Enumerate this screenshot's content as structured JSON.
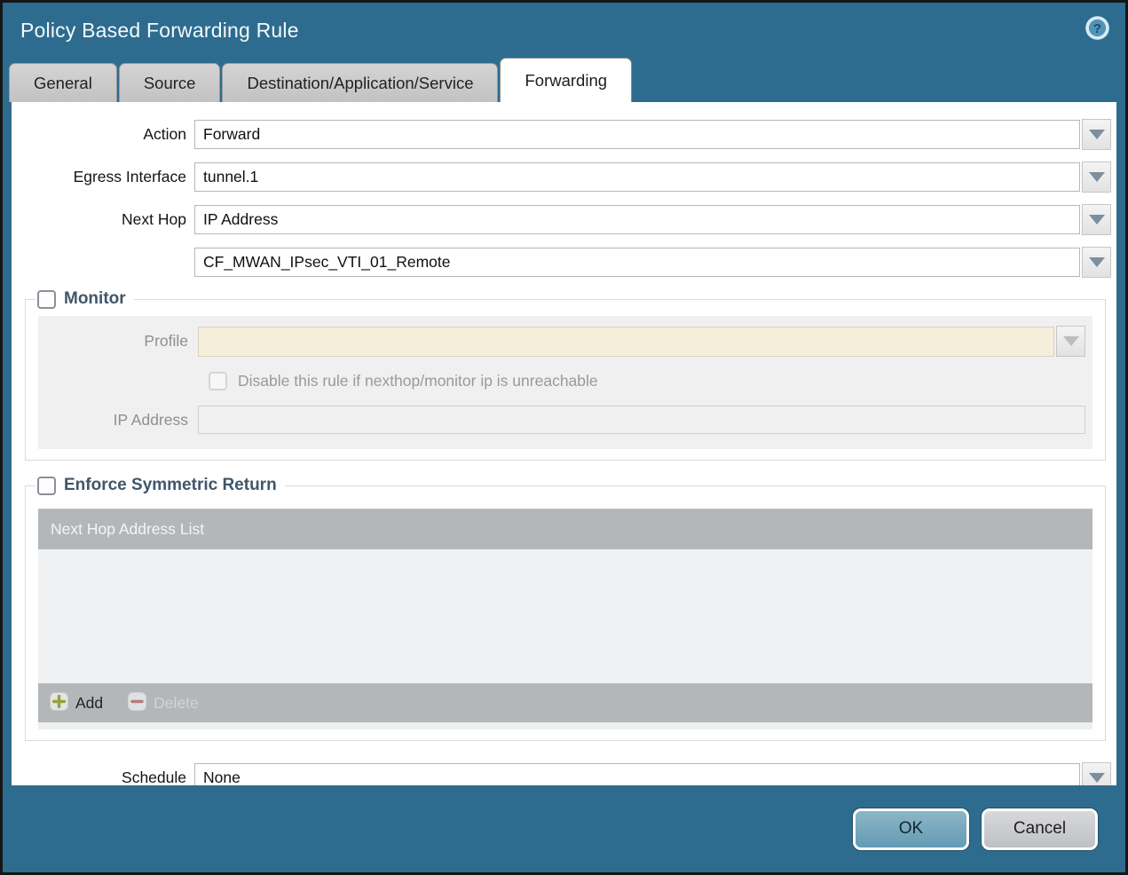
{
  "dialog": {
    "title": "Policy Based Forwarding Rule",
    "help_icon": "question-mark-circle-icon"
  },
  "tabs": [
    {
      "label": "General",
      "active": false
    },
    {
      "label": "Source",
      "active": false
    },
    {
      "label": "Destination/Application/Service",
      "active": false
    },
    {
      "label": "Forwarding",
      "active": true
    }
  ],
  "fields": {
    "action": {
      "label": "Action",
      "value": "Forward"
    },
    "egress_interface": {
      "label": "Egress Interface",
      "value": "tunnel.1"
    },
    "next_hop": {
      "label": "Next Hop",
      "value": "IP Address"
    },
    "next_hop_address": {
      "value": "CF_MWAN_IPsec_VTI_01_Remote"
    },
    "schedule": {
      "label": "Schedule",
      "value": "None"
    }
  },
  "monitor": {
    "label": "Monitor",
    "checked": false,
    "profile": {
      "label": "Profile",
      "value": ""
    },
    "disable_rule": {
      "label": "Disable this rule if nexthop/monitor ip is unreachable",
      "checked": false
    },
    "ip_address": {
      "label": "IP Address",
      "value": ""
    }
  },
  "enforce_symmetric_return": {
    "label": "Enforce Symmetric Return",
    "checked": false,
    "table": {
      "header": "Next Hop Address List",
      "rows": []
    },
    "add_label": "Add",
    "delete_label": "Delete"
  },
  "footer": {
    "ok_label": "OK",
    "cancel_label": "Cancel"
  },
  "colors": {
    "header_teal": "#2d6c8e",
    "tab_gray": "#c9c9c9",
    "active_tab_white": "#ffffff",
    "disabled_field_beige": "#f5eedb",
    "table_header_gray": "#b3b7ba",
    "ok_button_blue": "#72a6bc",
    "cancel_button_gray": "#c7c9cb",
    "add_plus_green": "#95a13d",
    "delete_minus_red": "#b57d7d",
    "legend_text": "#40566a"
  }
}
